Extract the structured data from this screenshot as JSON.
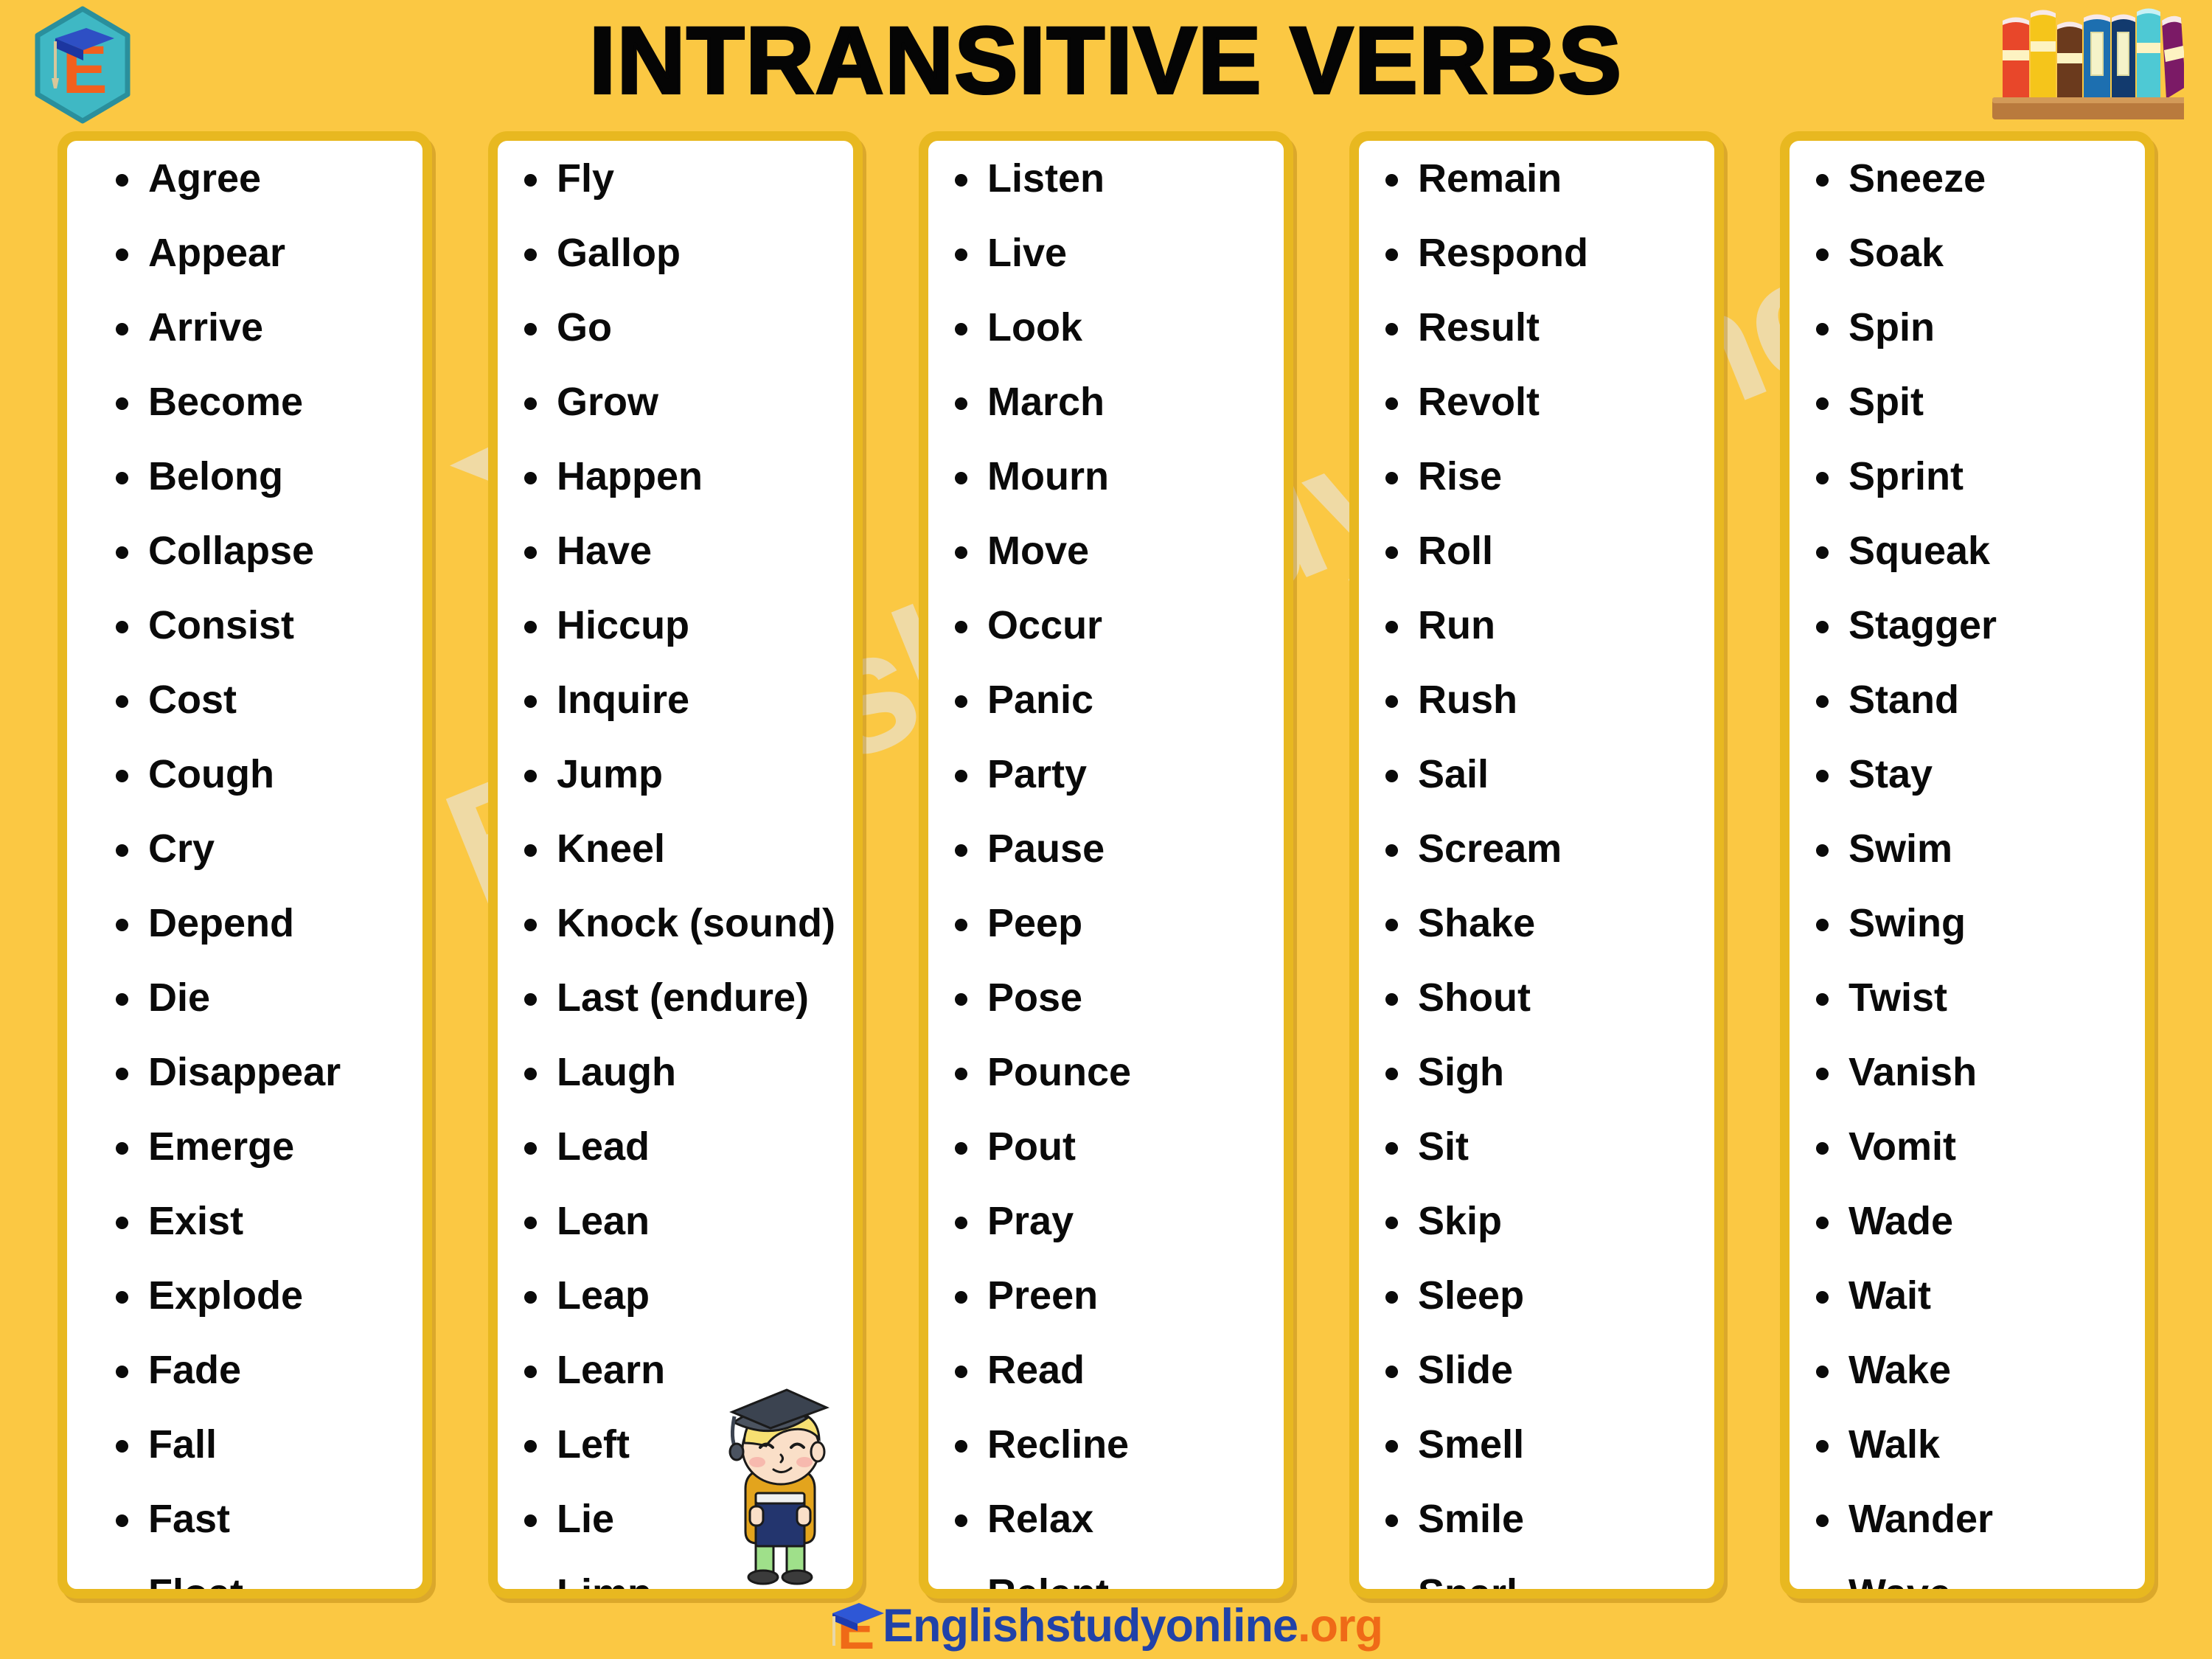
{
  "header": {
    "title": "INTRANSITIVE VERBS",
    "brand_logo_letter": "E",
    "brand_logo_name": "hexagon-graduation-logo",
    "books_icon_name": "books-on-shelf-icon"
  },
  "watermark": {
    "text": "Englishstudyonline.org"
  },
  "colors": {
    "page_background": "#fbc843",
    "card_border": "#e8b820",
    "card_background": "#ffffff",
    "title_text": "#050505",
    "verb_text": "#0a0a0a",
    "footer_text": "#2142a8",
    "footer_accent": "#ef6a17",
    "logo_hex": "#3fb8c4",
    "logo_letter": "#f2601d",
    "logo_cap": "#2e4fc4"
  },
  "columns": [
    {
      "name": "column-1",
      "items": [
        "Agree",
        "Appear",
        "Arrive",
        "Become",
        "Belong",
        "Collapse",
        "Consist",
        "Cost",
        "Cough",
        "Cry",
        "Depend",
        "Die",
        "Disappear",
        "Emerge",
        "Exist",
        "Explode",
        "Fade",
        "Fall",
        "Fast",
        "Float"
      ]
    },
    {
      "name": "column-2",
      "items": [
        "Fly",
        "Gallop",
        "Go",
        "Grow",
        "Happen",
        "Have",
        "Hiccup",
        "Inquire",
        "Jump",
        "Kneel",
        "Knock (sound)",
        "Last (endure)",
        "Laugh",
        "Lead",
        "Lean",
        "Leap",
        "Learn",
        "Left",
        "Lie",
        "Limp"
      ]
    },
    {
      "name": "column-3",
      "items": [
        "Listen",
        "Live",
        "Look",
        "March",
        "Mourn",
        "Move",
        "Occur",
        "Panic",
        "Party",
        "Pause",
        "Peep",
        "Pose",
        "Pounce",
        "Pout",
        "Pray",
        "Preen",
        "Read",
        "Recline",
        "Relax",
        "Relent"
      ]
    },
    {
      "name": "column-4",
      "items": [
        "Remain",
        "Respond",
        "Result",
        "Revolt",
        "Rise",
        "Roll",
        "Run",
        "Rush",
        "Sail",
        "Scream",
        "Shake",
        "Shout",
        "Sigh",
        "Sit",
        "Skip",
        "Sleep",
        "Slide",
        "Smell",
        "Smile",
        "Snarl"
      ]
    },
    {
      "name": "column-5",
      "items": [
        "Sneeze",
        "Soak",
        "Spin",
        "Spit",
        "Sprint",
        "Squeak",
        "Stagger",
        "Stand",
        "Stay",
        "Swim",
        "Swing",
        "Twist",
        "Vanish",
        "Vomit",
        "Wade",
        "Wait",
        "Wake",
        "Walk",
        "Wander",
        "Wave"
      ]
    }
  ],
  "mascot": {
    "name": "graduate-student-character"
  },
  "footer": {
    "site_name": "Englishstudyonline",
    "tld": ".org",
    "logo_letter": "E"
  }
}
